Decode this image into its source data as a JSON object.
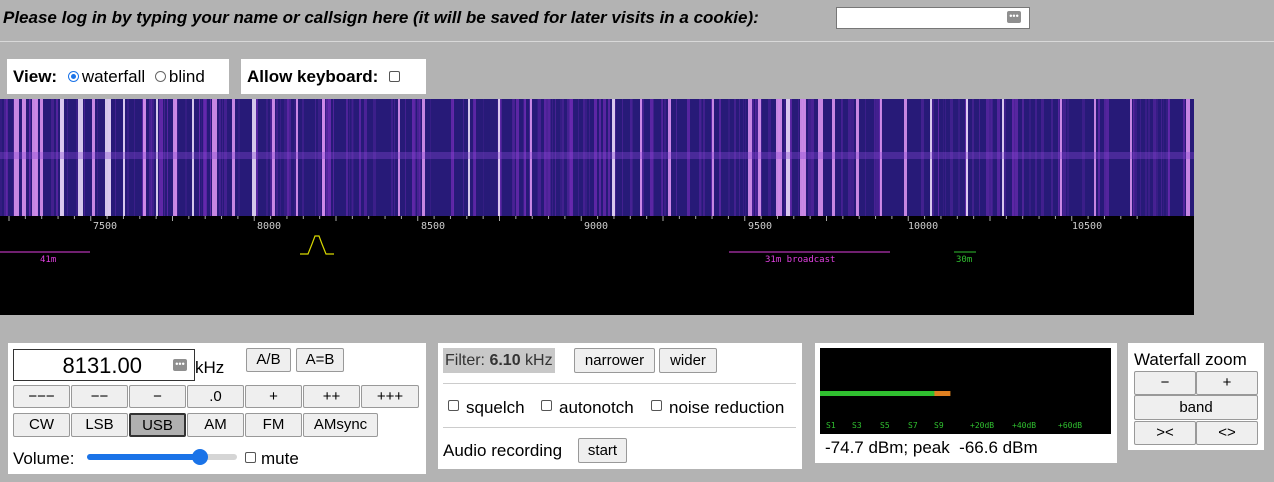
{
  "login": {
    "prompt": "Please log in by typing your name or callsign here (it will be saved for later visits in a cookie):",
    "value": "",
    "placeholder": ""
  },
  "view": {
    "label": "View:",
    "options": [
      "waterfall",
      "blind"
    ],
    "selected": "waterfall"
  },
  "keyboard": {
    "label": "Allow keyboard:",
    "checked": false
  },
  "scale": {
    "ticks": [
      "7500",
      "8000",
      "8500",
      "9000",
      "9500",
      "10000",
      "10500"
    ],
    "bands": [
      {
        "label": "41m",
        "color": "#e040e0"
      },
      {
        "label": "31m broadcast",
        "color": "#e040e0"
      },
      {
        "label": "30m",
        "color": "#30c030"
      }
    ]
  },
  "frequency": {
    "value": "8131.00",
    "unit": "kHz",
    "vfo_buttons": [
      "A/B",
      "A=B"
    ],
    "step_buttons": [
      "−−−",
      "−−",
      "−",
      ".0",
      "+",
      "++",
      "+++"
    ],
    "modes": [
      "CW",
      "LSB",
      "USB",
      "AM",
      "FM",
      "AMsync"
    ],
    "active_mode": "USB",
    "volume_label": "Volume:",
    "volume_level": 0.75,
    "mute_label": "mute",
    "mute_checked": false
  },
  "filter": {
    "label": "Filter:",
    "value": "6.10",
    "unit": "kHz",
    "narrower": "narrower",
    "wider": "wider"
  },
  "options": {
    "squelch": "squelch",
    "autonotch": "autonotch",
    "noise_reduction": "noise reduction"
  },
  "recording": {
    "label": "Audio recording",
    "button": "start"
  },
  "smeter": {
    "labels": [
      "S1",
      "S3",
      "S5",
      "S7",
      "S9",
      "+20dB",
      "+40dB",
      "+60dB"
    ],
    "readout": "-74.7 dBm; peak  -66.6 dBm",
    "level_fraction": 0.4,
    "colors": {
      "bar": "#30c030",
      "peak": "#e08020",
      "text": "#30c030"
    }
  },
  "zoom": {
    "title": "Waterfall zoom",
    "minus": "−",
    "plus": "+",
    "band": "band",
    "in": "><",
    "out": "<>"
  },
  "colors": {
    "background": "#b3b3b3",
    "waterfall": "#271a78",
    "accent": "#1a73e8"
  }
}
